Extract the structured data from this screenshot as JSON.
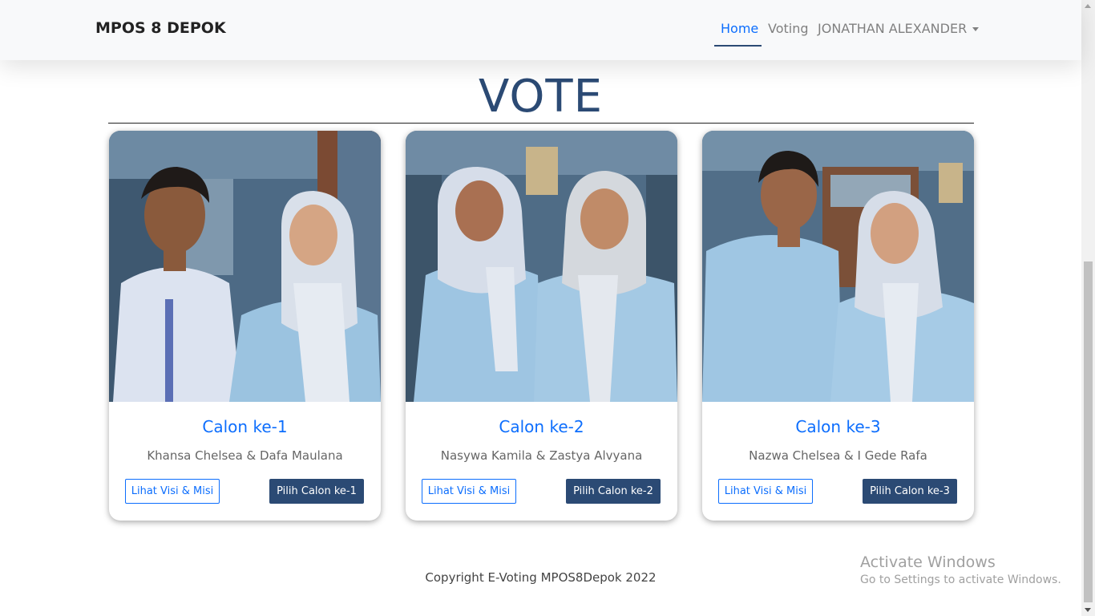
{
  "navbar": {
    "brand": "MPOS 8 DEPOK",
    "links": [
      {
        "label": "Home",
        "active": true
      },
      {
        "label": "Voting",
        "active": false
      }
    ],
    "user_menu": "JONATHAN ALEXANDER"
  },
  "page": {
    "title": "VOTE"
  },
  "candidates": [
    {
      "title": "Calon ke-1",
      "names": "Khansa Chelsea & Dafa Maulana",
      "vision_button": "Lihat Visi & Misi",
      "choose_button": "Pilih Calon ke-1"
    },
    {
      "title": "Calon ke-2",
      "names": "Nasywa Kamila & Zastya Alvyana",
      "vision_button": "Lihat Visi & Misi",
      "choose_button": "Pilih Calon ke-2"
    },
    {
      "title": "Calon ke-3",
      "names": "Nazwa Chelsea & I Gede Rafa",
      "vision_button": "Lihat Visi & Misi",
      "choose_button": "Pilih Calon ke-3"
    }
  ],
  "footer": {
    "copyright": "Copyright E-Voting MPOS8Depok 2022"
  },
  "os_watermark": {
    "line1": "Activate Windows",
    "line2": "Go to Settings to activate Windows."
  },
  "colors": {
    "accent": "#0d6efd",
    "primary_dark": "#2b4a74",
    "navbar_bg": "#f8f9fa"
  }
}
